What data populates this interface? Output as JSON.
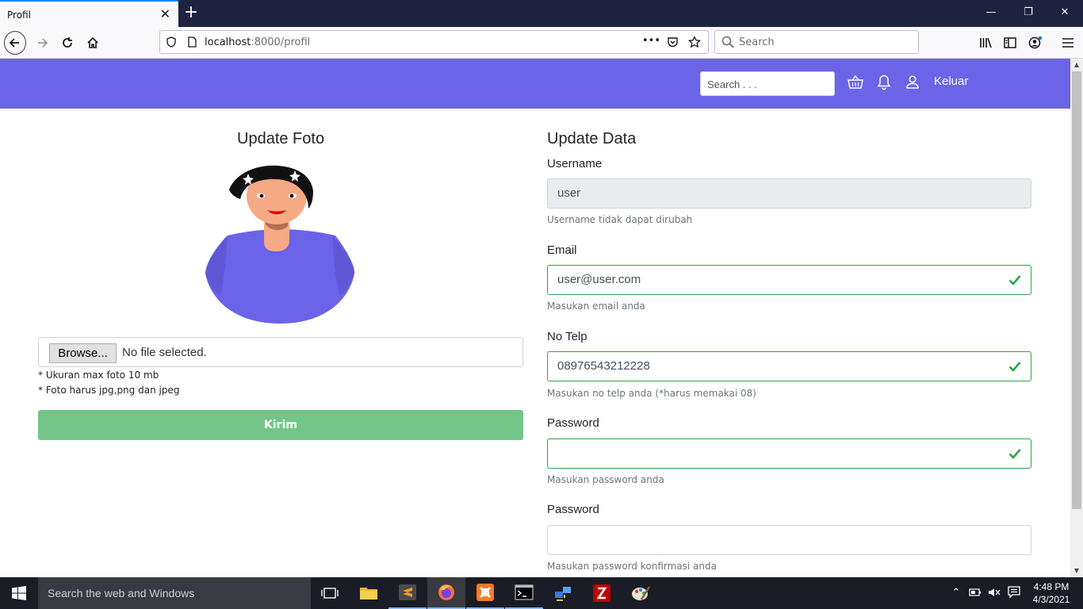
{
  "browser": {
    "tab_title": "Profil",
    "tab_close": "✕",
    "new_tab": "+",
    "window_controls": {
      "minimize": "—",
      "restore": "❐",
      "close": "✕"
    },
    "url_host": "localhost",
    "url_path": ":8000/profil",
    "url_more": "•••",
    "search_placeholder": "Search"
  },
  "header": {
    "search_placeholder": "Search . . .",
    "logout_label": "Keluar",
    "brand_color": "#6b63e8"
  },
  "photo": {
    "title": "Update Foto",
    "browse_label": "Browse...",
    "file_status": "No file selected.",
    "notes": [
      "* Ukuran max foto 10 mb",
      "* Foto harus jpg,png dan jpeg"
    ],
    "submit_label": "Kirim"
  },
  "form": {
    "title": "Update Data",
    "fields": [
      {
        "label": "Username",
        "value": "user",
        "help": "Username tidak dapat dirubah",
        "state": "disabled"
      },
      {
        "label": "Email",
        "value": "user@user.com",
        "help": "Masukan email anda",
        "state": "valid"
      },
      {
        "label": "No Telp",
        "value": "08976543212228",
        "help": "Masukan no telp anda (*harus memakai 08)",
        "state": "valid"
      },
      {
        "label": "Password",
        "value": "",
        "help": "Masukan password anda",
        "state": "valid"
      },
      {
        "label": "Password",
        "value": "",
        "help": "Masukan password konfirmasi anda",
        "state": "plain"
      }
    ],
    "valid_color": "#28a745"
  },
  "taskbar": {
    "search_text": "Search the web and Windows",
    "time": "4:48 PM",
    "date": "4/3/2021"
  }
}
